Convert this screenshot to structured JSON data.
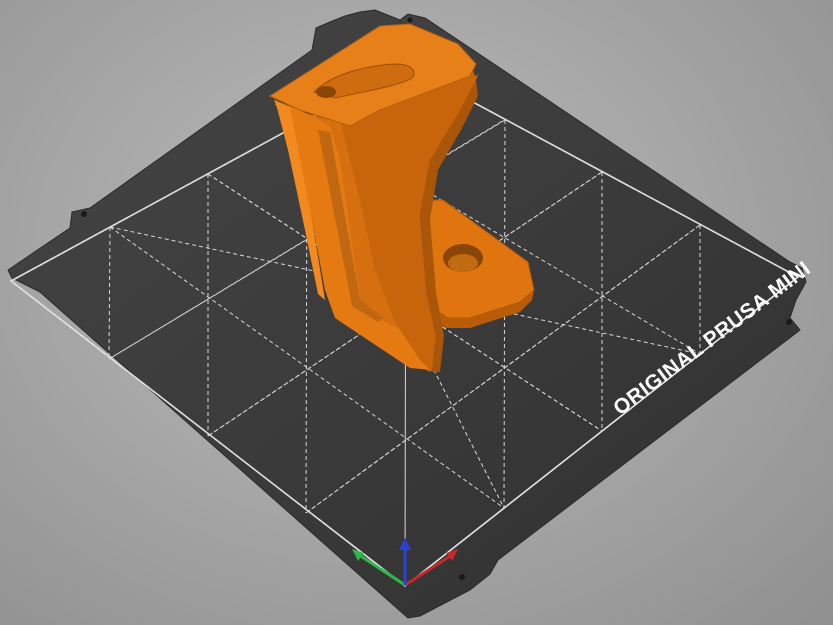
{
  "app": {
    "view": "3D plater viewport"
  },
  "bed": {
    "label": "ORIGINAL PRUSA MINI",
    "surface_color": "#3a3a3a",
    "grid_color": "#d9d9d9",
    "grid_divisions": 4
  },
  "model": {
    "color": "#e67a12",
    "shade_color": "#b85c0a",
    "highlight_color": "#f28a20"
  },
  "axes": {
    "x_color": "#c62a2a",
    "y_color": "#2fb84a",
    "z_color": "#2d3fd6"
  }
}
